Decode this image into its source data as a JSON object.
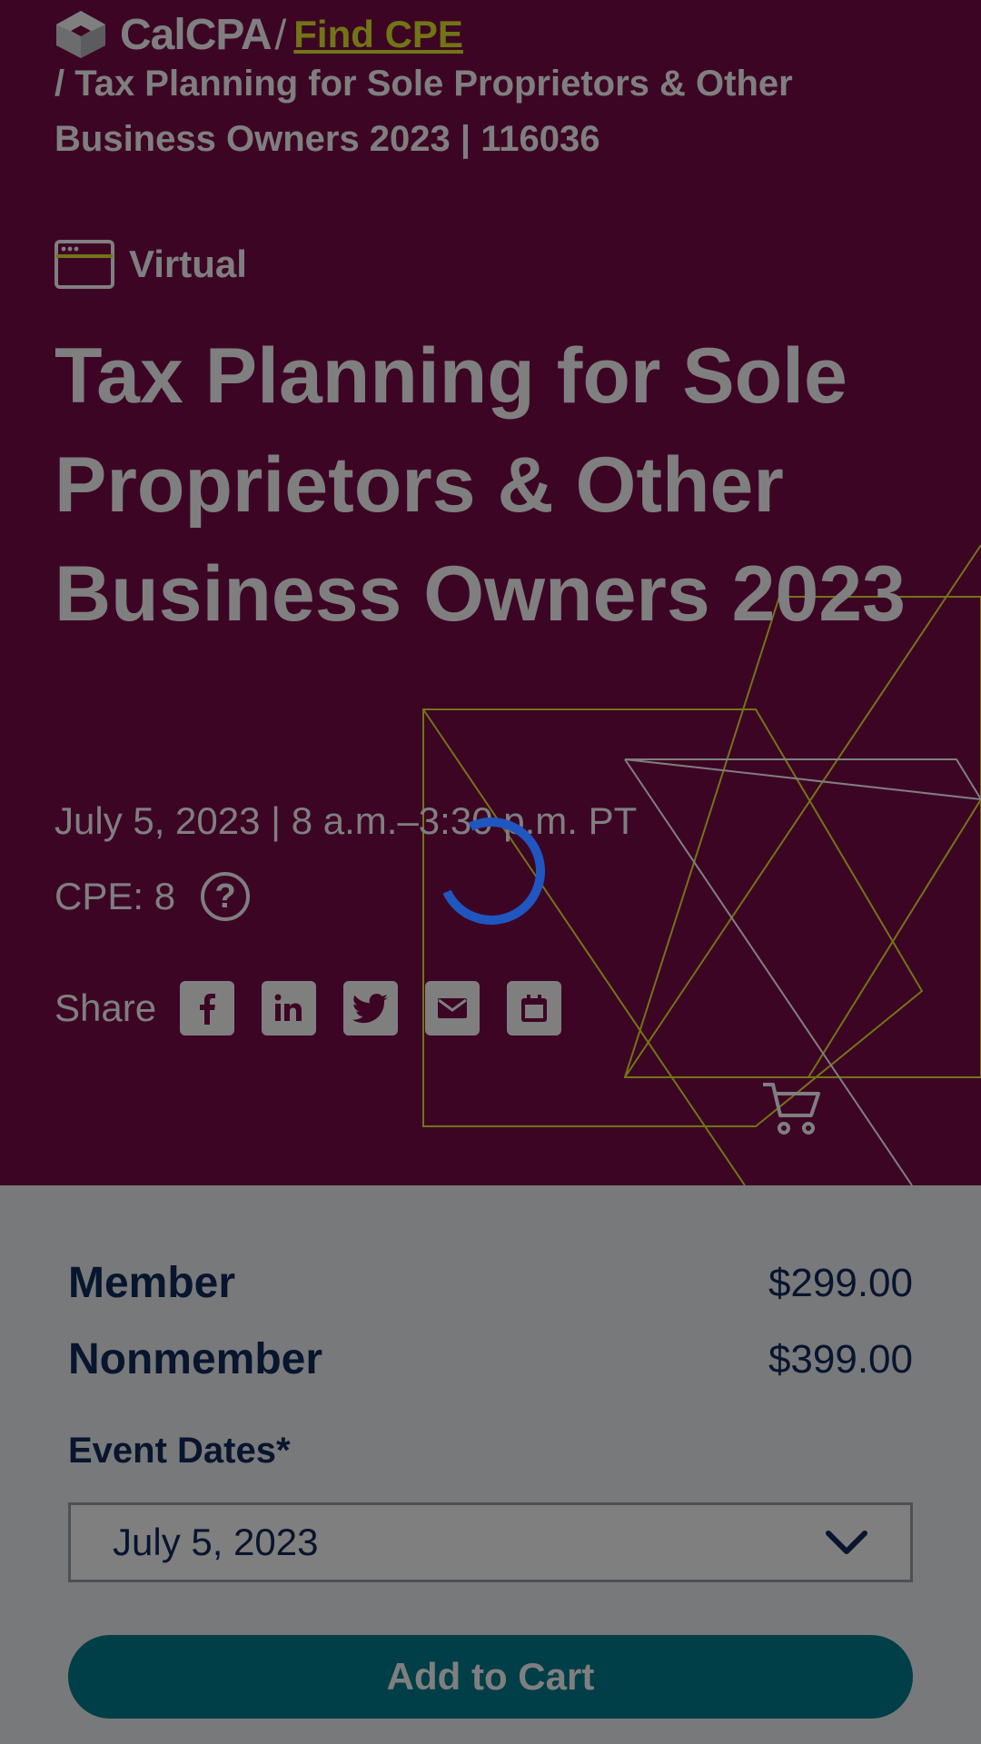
{
  "header": {
    "logo_text": "CalCPA",
    "separator": "/",
    "find_link": "Find CPE",
    "breadcrumb": "/ Tax Planning for Sole Proprietors & Other Business Owners 2023 | 116036"
  },
  "event": {
    "format_label": "Virtual",
    "title": "Tax Planning for Sole Proprietors & Other Business Owners 2023",
    "date_time": "July 5, 2023 | 8 a.m.–3:30 p.m. PT",
    "cpe": "CPE: 8",
    "help_symbol": "?",
    "share_label": "Share",
    "share_icons": [
      "facebook-icon",
      "linkedin-icon",
      "twitter-icon",
      "email-icon",
      "calendar-icon"
    ]
  },
  "pricing": {
    "member_label": "Member",
    "member_price": "$299.00",
    "nonmember_label": "Nonmember",
    "nonmember_price": "$399.00"
  },
  "event_dates": {
    "label": "Event Dates*",
    "selected": "July 5, 2023"
  },
  "actions": {
    "add_to_cart": "Add to Cart"
  },
  "colors": {
    "hero": "#7a0a49",
    "accent": "#e3ea2a",
    "primary_button": "#007f8f",
    "navy_text": "#0e2a5c",
    "spinner": "#1f56c0"
  }
}
